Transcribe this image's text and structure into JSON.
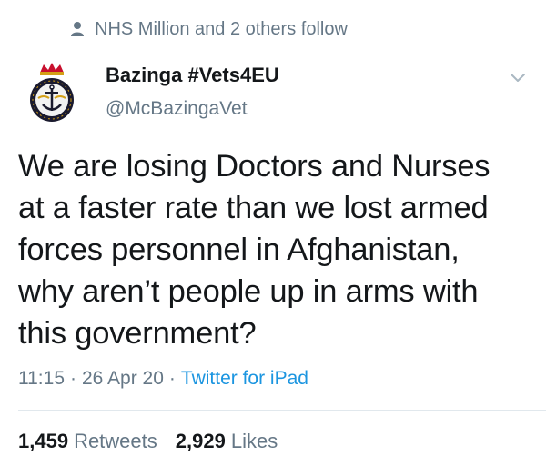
{
  "social_context": {
    "text": "NHS Million and 2 others follow",
    "icon": "person-icon"
  },
  "author": {
    "name": "Bazinga #Vets4EU",
    "handle": "@McBazingaVet",
    "avatar": "royal-navy-crest"
  },
  "tweet": {
    "lines": [
      "We are losing Doctors and Nurses",
      "at a faster rate than we lost armed",
      "forces personnel in Afghanistan,",
      "why aren’t people up in arms with",
      "this government?"
    ]
  },
  "meta": {
    "time": "11:15",
    "date": "26 Apr 20",
    "source": "Twitter for iPad",
    "separator": "·"
  },
  "stats": {
    "retweets_count": "1,459",
    "retweets_label": "Retweets",
    "likes_count": "2,929",
    "likes_label": "Likes"
  },
  "colors": {
    "text": "#14171a",
    "secondary": "#657786",
    "link": "#1b95e0",
    "divider": "#e1e8ed"
  }
}
